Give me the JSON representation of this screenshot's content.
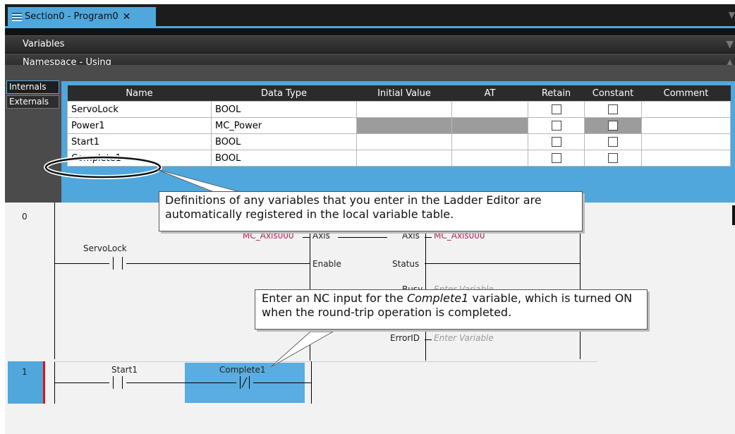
{
  "tab": {
    "title": "Section0 - Program0",
    "close": "✕"
  },
  "panels": {
    "variables": "Variables",
    "namespace": "Namespace - Using"
  },
  "var_tabs": [
    "Internals",
    "Externals"
  ],
  "table": {
    "headers": [
      "Name",
      "Data Type",
      "Initial Value",
      "AT",
      "Retain",
      "Constant",
      "Comment"
    ],
    "rows": [
      {
        "name": "ServoLock",
        "type": "BOOL"
      },
      {
        "name": "Power1",
        "type": "MC_Power"
      },
      {
        "name": "Start1",
        "type": "BOOL"
      },
      {
        "name": "Complete1",
        "type": "BOOL"
      }
    ]
  },
  "ladder": {
    "row0": "0",
    "row1": "1",
    "servolock": "ServoLock",
    "axis_in_var": "MC_Axis000",
    "axis_in_pin": "Axis",
    "enable_pin": "Enable",
    "axis_out_pin": "Axis",
    "axis_out_var": "MC_Axis000",
    "status_pin": "Status",
    "busy_pin": "Busy",
    "busy_var": "Enter Variable",
    "errorid_pin": "ErrorID",
    "errorid_var": "Enter Variable",
    "start1": "Start1",
    "complete1": "Complete1"
  },
  "callouts": {
    "top": "Definitions of any variables that you enter in the Ladder Editor are automatically registered in the local variable table.",
    "bottom_pre": "Enter an NC input for the ",
    "bottom_em": "Complete1",
    "bottom_post": " variable, which is turned ON when the round-trip operation is completed."
  },
  "colors": {
    "accent": "#4fa7dc",
    "dark": "#2b2b2b",
    "variable_red": "#b2245a"
  }
}
